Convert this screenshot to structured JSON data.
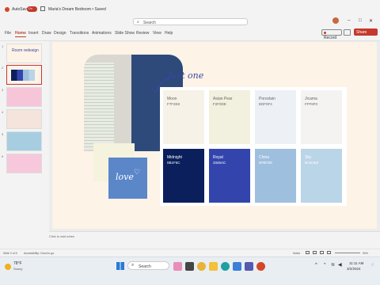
{
  "titlebar": {
    "autosave_label": "AutoSave",
    "autosave_state": "On",
    "doc_title": "Maria's Dream Bedroom • Saved",
    "search_placeholder": "Search"
  },
  "ribbon": {
    "tabs": [
      "File",
      "Home",
      "Insert",
      "Draw",
      "Design",
      "Transitions",
      "Animations",
      "Slide Show",
      "Review",
      "View",
      "Help"
    ],
    "active_tab": "Home",
    "record_label": "Record",
    "share_label": "Share"
  },
  "thumbnails": {
    "numbers": [
      "1",
      "2",
      "3",
      "4",
      "5",
      "6"
    ],
    "slide1_title": "Room redesign"
  },
  "slide": {
    "annotation_text": "Just one",
    "love_text": "love",
    "swatches": [
      {
        "name": "Moon",
        "code": "F7F2E8",
        "color": "#F7F2E8",
        "text_color": "#666666"
      },
      {
        "name": "Asian Pear",
        "code": "F2F0DE",
        "color": "#F2F0DE",
        "text_color": "#666666"
      },
      {
        "name": "Porcelain",
        "code": "EDF0F4",
        "color": "#EDF0F4",
        "text_color": "#666666"
      },
      {
        "name": "Jicama",
        "code": "FFF8F0",
        "color": "#F5F3F1",
        "text_color": "#666666"
      },
      {
        "name": "Midnight",
        "code": "0B1F5C",
        "color": "#0B1F5C",
        "text_color": "#ffffff"
      },
      {
        "name": "Royal",
        "code": "3345AC",
        "color": "#3345AC",
        "text_color": "#ffffff"
      },
      {
        "name": "China",
        "code": "9FBFDE",
        "color": "#9FBFDE",
        "text_color": "#ffffff"
      },
      {
        "name": "Sky",
        "code": "BAD4E8",
        "color": "#BAD4E8",
        "text_color": "#ffffff"
      }
    ]
  },
  "notes": {
    "placeholder": "Click to add notes"
  },
  "statusbar": {
    "slide_info": "Slide 2 of 6",
    "accessibility": "Accessibility: Good to go",
    "notes_label": "Notes",
    "zoom": "90%"
  },
  "taskbar": {
    "weather_temp": "78°F",
    "weather_desc": "Sunny",
    "search_label": "Search",
    "time": "11:11 AM",
    "date": "3/2/2024"
  }
}
